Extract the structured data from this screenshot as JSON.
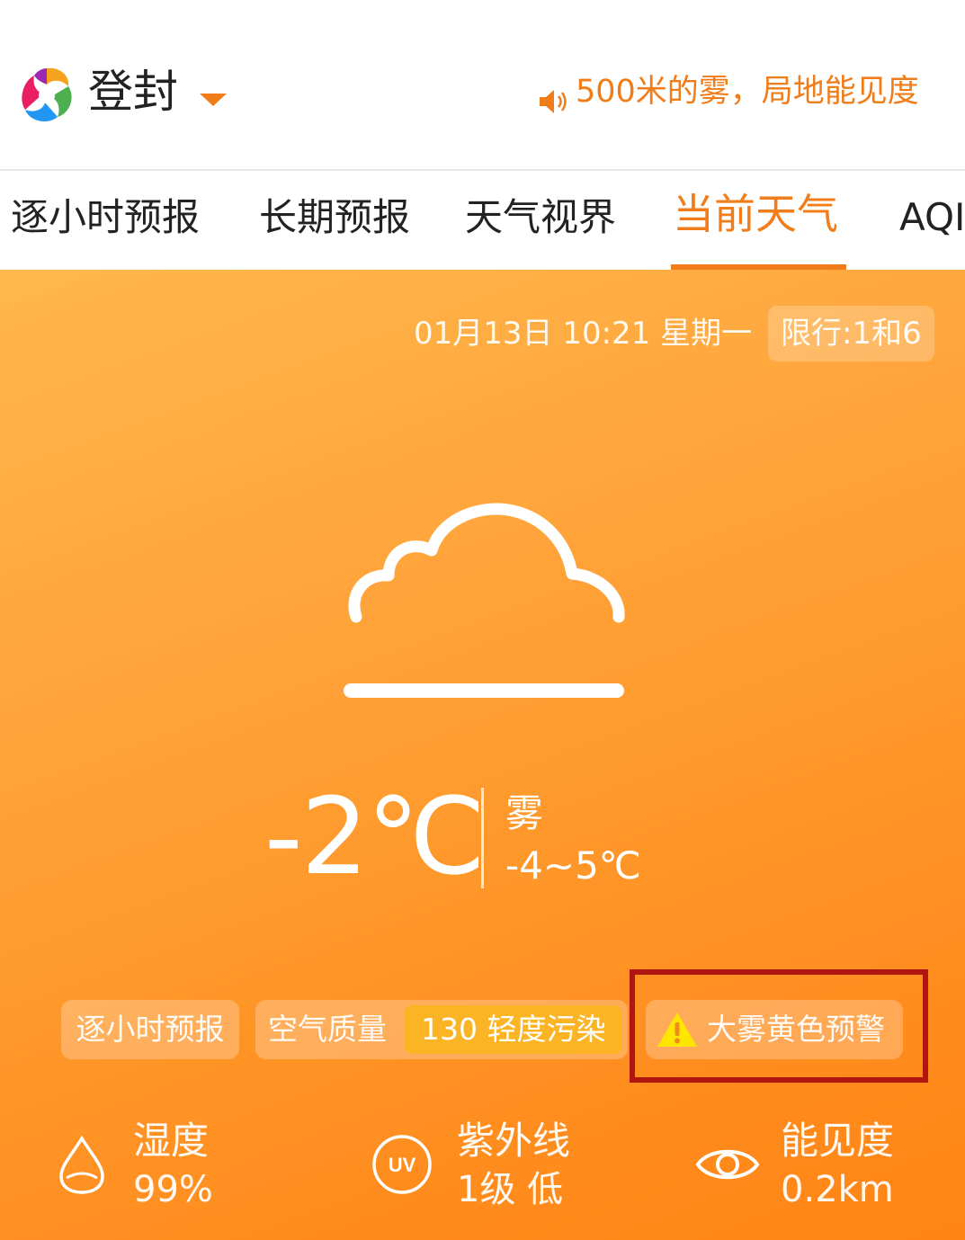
{
  "header": {
    "city": "登封",
    "alert_ticker": "500米的雾，局地能见度"
  },
  "tabs": [
    {
      "label": "逐小时预报",
      "active": false
    },
    {
      "label": "长期预报",
      "active": false
    },
    {
      "label": "天气视界",
      "active": false
    },
    {
      "label": "当前天气",
      "active": true
    },
    {
      "label": "AQI",
      "active": false
    }
  ],
  "current": {
    "datetime": "01月13日 10:21 星期一",
    "restriction": "限行:1和6",
    "temperature": "-2℃",
    "condition": "雾",
    "range": "-4~5℃"
  },
  "chips": {
    "hourly": "逐小时预报",
    "aqi_label": "空气质量",
    "aqi_value": "130 轻度污染",
    "warning": "大雾黄色预警"
  },
  "stats": {
    "humidity": {
      "label": "湿度",
      "value": "99%"
    },
    "uv": {
      "label": "紫外线",
      "value": "1级 低",
      "icon_text": "UV"
    },
    "visibility": {
      "label": "能见度",
      "value": "0.2km"
    }
  },
  "colors": {
    "accent": "#f07c1a",
    "aqi_badge": "#fbb424",
    "highlight_box": "#b0160f",
    "warning_icon": "#ffe600"
  },
  "icons": {
    "logo": "swirl-logo-icon",
    "speaker": "speaker-icon",
    "weather": "fog-cloud-icon",
    "warning": "warning-triangle-icon",
    "humidity": "droplet-icon",
    "uv": "uv-circle-icon",
    "visibility": "eye-icon"
  }
}
